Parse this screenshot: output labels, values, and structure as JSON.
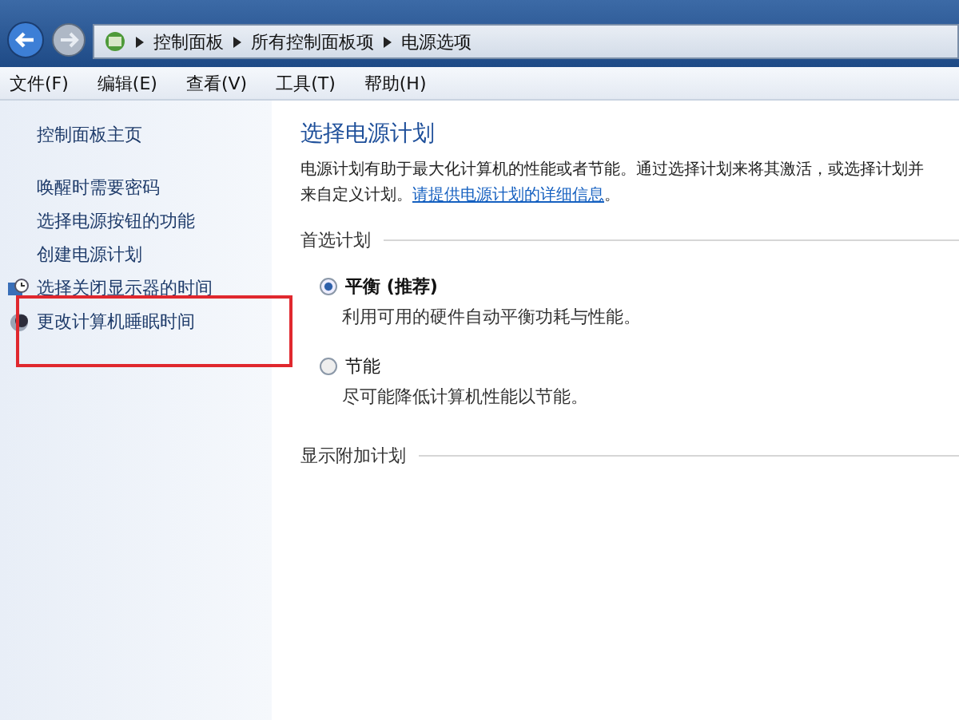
{
  "address_bar": {
    "crumbs": [
      "控制面板",
      "所有控制面板项",
      "电源选项"
    ]
  },
  "menu": [
    "文件(F)",
    "编辑(E)",
    "查看(V)",
    "工具(T)",
    "帮助(H)"
  ],
  "sidebar": {
    "home": "控制面板主页",
    "items": [
      {
        "label": "唤醒时需要密码",
        "kind": "plain",
        "highlighted": false
      },
      {
        "label": "选择电源按钮的功能",
        "kind": "plain",
        "highlighted": false
      },
      {
        "label": "创建电源计划",
        "kind": "plain",
        "highlighted": false
      },
      {
        "label": "选择关闭显示器的时间",
        "kind": "display",
        "highlighted": false
      },
      {
        "label": "更改计算机睡眠时间",
        "kind": "sleep",
        "highlighted": true
      }
    ]
  },
  "content": {
    "title": "选择电源计划",
    "description_lines": [
      "电源计划有助于最大化计算机的性能或者节能。通过选择计划来将其激活，或选择计划并",
      "来自定义计划。"
    ],
    "link": "请提供电源计划的详细信息",
    "after_link": "。",
    "group": "首选计划",
    "plans": [
      {
        "name": "平衡 (推荐)",
        "description": "利用可用的硬件自动平衡功耗与性能。",
        "selected": true
      },
      {
        "name": "节能",
        "description": "尽可能降低计算机性能以节能。",
        "selected": false
      }
    ],
    "more": "显示附加计划"
  }
}
